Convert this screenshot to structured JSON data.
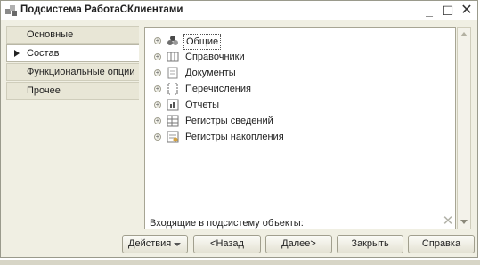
{
  "window": {
    "title": "Подсистема РаботаСКлиентами",
    "minimize_glyph": "_",
    "maximize_glyph": "☐",
    "close_glyph": "✕"
  },
  "sidebar": {
    "items": [
      {
        "label": "Основные",
        "active": false
      },
      {
        "label": "Состав",
        "active": true
      },
      {
        "label": "Функциональные опции",
        "active": false
      },
      {
        "label": "Прочее",
        "active": false
      }
    ]
  },
  "tree": {
    "nodes": [
      {
        "label": "Общие",
        "icon": "common-icon",
        "selected": true
      },
      {
        "label": "Справочники",
        "icon": "catalogs-icon",
        "selected": false
      },
      {
        "label": "Документы",
        "icon": "documents-icon",
        "selected": false
      },
      {
        "label": "Перечисления",
        "icon": "enums-icon",
        "selected": false
      },
      {
        "label": "Отчеты",
        "icon": "reports-icon",
        "selected": false
      },
      {
        "label": "Регистры сведений",
        "icon": "info-registers-icon",
        "selected": false
      },
      {
        "label": "Регистры накопления",
        "icon": "accumulation-registers-icon",
        "selected": false
      }
    ],
    "expander_glyph": "+",
    "footer_label": "Входящие в подсистему объекты:",
    "clear_glyph": "✕"
  },
  "buttons": {
    "actions": "Действия",
    "back": "<Назад",
    "next": "Далее>",
    "finish": "Закрыть",
    "help": "Справка"
  }
}
